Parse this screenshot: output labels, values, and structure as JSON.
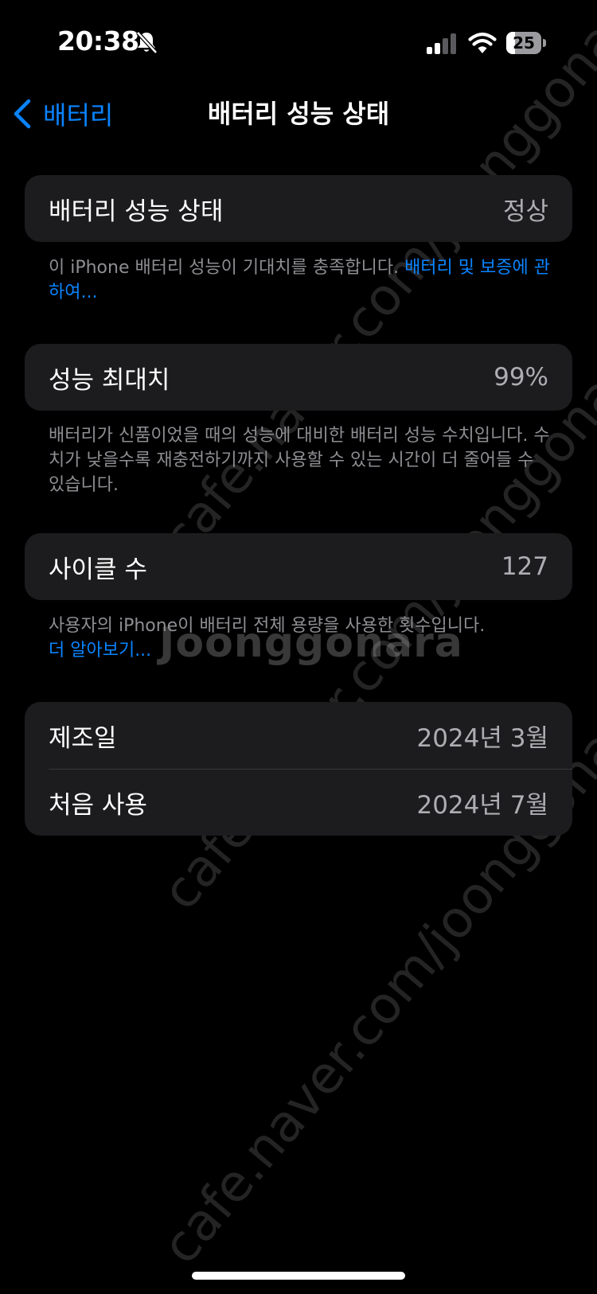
{
  "status_bar": {
    "time": "20:38",
    "battery_level": "25",
    "battery_fraction": 0.25,
    "icons": [
      "bell-slash-icon",
      "cellular-signal-icon",
      "wifi-icon",
      "battery-icon"
    ]
  },
  "nav": {
    "back_label": "배터리",
    "title": "배터리 성능 상태"
  },
  "sections": {
    "health": {
      "label": "배터리 성능 상태",
      "value": "정상",
      "footnote_text": "이 iPhone 배터리 성능이 기대치를 충족합니다. ",
      "footnote_link": "배터리 및 보증에 관하여..."
    },
    "max_capacity": {
      "label": "성능 최대치",
      "value": "99%",
      "footnote_text": "배터리가 신품이었을 때의 성능에 대비한 배터리 성능 수치입니다. 수치가 낮을수록 재충전하기까지 사용할 수 있는 시간이 더 줄어들 수 있습니다."
    },
    "cycle_count": {
      "label": "사이클 수",
      "value": "127",
      "footnote_text": "사용자의 iPhone이 배터리 전체 용량을 사용한 횟수입니다.",
      "footnote_link": "더 알아보기..."
    },
    "dates": {
      "manufacture_label": "제조일",
      "manufacture_value": "2024년 3월",
      "first_use_label": "처음 사용",
      "first_use_value": "2024년 7월"
    }
  },
  "watermark": {
    "url_text": "cafe.naver.com/joonggonara",
    "logo_text": "Joonggonara"
  },
  "colors": {
    "background": "#000000",
    "card": "#1c1c1e",
    "accent": "#0a84ff",
    "secondary_text": "#aeaeb2",
    "footnote_text": "#8e8e93"
  }
}
